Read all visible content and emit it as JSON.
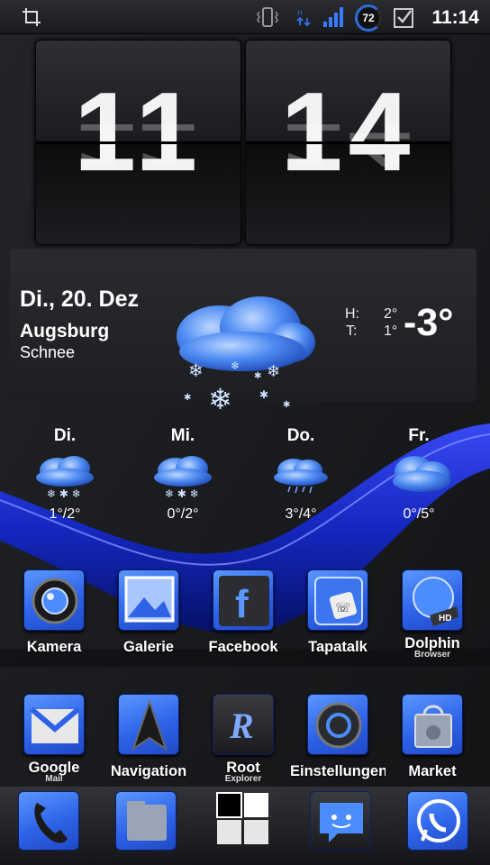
{
  "status_bar": {
    "time": "11:14",
    "battery": "72"
  },
  "clock": {
    "hours": "11",
    "minutes": "14"
  },
  "weather": {
    "date": "Di., 20. Dez",
    "city": "Augsburg",
    "condition": "Schnee",
    "high_label": "H:",
    "high_value": "2°",
    "low_label": "T:",
    "low_value": "1°",
    "current_temp": "-3°"
  },
  "forecast": [
    {
      "day": "Di.",
      "temps": "1°/2°",
      "icon": "snow-cloud-icon"
    },
    {
      "day": "Mi.",
      "temps": "0°/2°",
      "icon": "snow-cloud-icon"
    },
    {
      "day": "Do.",
      "temps": "3°/4°",
      "icon": "rain-cloud-icon"
    },
    {
      "day": "Fr.",
      "temps": "0°/5°",
      "icon": "cloud-icon"
    }
  ],
  "apps_row1": [
    {
      "label": "Kamera",
      "sub": ""
    },
    {
      "label": "Galerie",
      "sub": ""
    },
    {
      "label": "Facebook",
      "sub": ""
    },
    {
      "label": "Tapatalk",
      "sub": ""
    },
    {
      "label": "Dolphin",
      "sub": "Browser"
    }
  ],
  "apps_row2": [
    {
      "label": "Google",
      "sub": "Mail"
    },
    {
      "label": "Navigation",
      "sub": ""
    },
    {
      "label": "Root",
      "sub": "Explorer"
    },
    {
      "label": "Einstellungen",
      "sub": ""
    },
    {
      "label": "Market",
      "sub": ""
    }
  ],
  "dock": [
    "phone-icon",
    "app-drawer-icon",
    "all-apps-grid-icon",
    "messaging-icon",
    "whatsapp-icon"
  ],
  "colors": {
    "accent": "#2e63e8",
    "wave": "#1a2fd6"
  }
}
